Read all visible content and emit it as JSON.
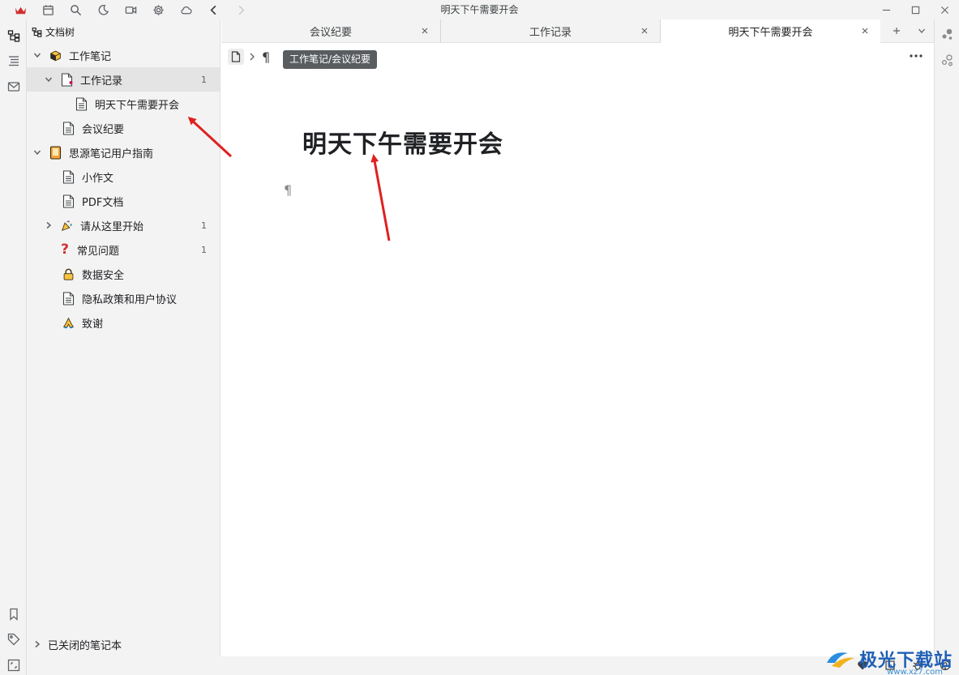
{
  "window": {
    "title": "明天下午需要开会"
  },
  "titlebar": {
    "icons": [
      "crown-icon",
      "calendar-icon",
      "search-icon",
      "moon-icon",
      "video-icon",
      "gear-icon",
      "cloud-icon",
      "back-icon",
      "forward-icon"
    ]
  },
  "tree": {
    "header_label": "文档树",
    "items": [
      {
        "label": "工作笔记",
        "count": ""
      },
      {
        "label": "工作记录",
        "count": "1"
      },
      {
        "label": "明天下午需要开会",
        "count": ""
      },
      {
        "label": "会议纪要",
        "count": ""
      },
      {
        "label": "思源笔记用户指南",
        "count": ""
      },
      {
        "label": "小作文",
        "count": ""
      },
      {
        "label": "PDF文档",
        "count": ""
      },
      {
        "label": "请从这里开始",
        "count": "1"
      },
      {
        "label": "常见问题",
        "count": "1"
      },
      {
        "label": "数据安全",
        "count": ""
      },
      {
        "label": "隐私政策和用户协议",
        "count": ""
      },
      {
        "label": "致谢",
        "count": ""
      }
    ],
    "closed_notebooks_label": "已关闭的笔记本"
  },
  "tabs": [
    {
      "label": "会议纪要"
    },
    {
      "label": "工作记录"
    },
    {
      "label": "明天下午需要开会"
    }
  ],
  "editor": {
    "breadcrumb_tooltip": "工作笔记/会议纪要",
    "para_symbol": "¶",
    "title": "明天下午需要开会",
    "empty_para": "¶"
  },
  "watermark": {
    "text": "极光下载站",
    "sub": "www.xz7.com"
  },
  "colors": {
    "arrow": "#e02020",
    "sidebar_bg": "#f3f3f3",
    "selected_bg": "#e4e4e4",
    "tooltip_bg": "#5a5d60"
  }
}
